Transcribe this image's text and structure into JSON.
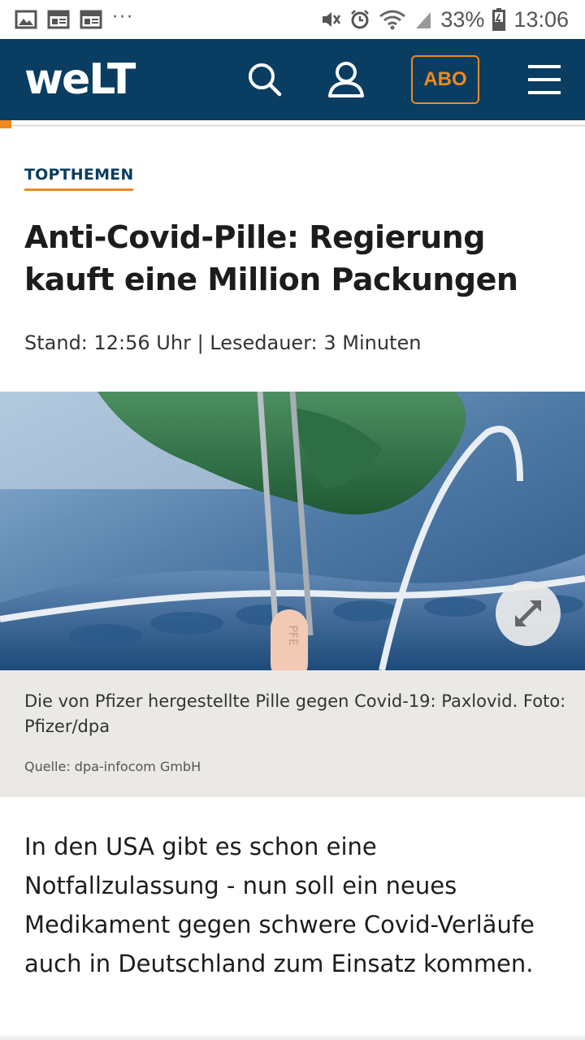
{
  "statusbar": {
    "battery": "33%",
    "time": "13:06",
    "left_icons": [
      "gallery-icon",
      "news-icon",
      "newspaper-icon",
      "more-dots-icon"
    ],
    "right_icons": [
      "mute-icon",
      "alarm-icon",
      "wifi-icon",
      "signal-icon",
      "battery-icon"
    ],
    "more": "···"
  },
  "header": {
    "logo": "weLT",
    "abo_label": "ABO",
    "background": "#0a3d62",
    "accent": "#ef8a1f",
    "icons": [
      "search-icon",
      "user-icon",
      "menu-icon"
    ]
  },
  "article": {
    "kicker": "TOPTHEMEN",
    "headline": "Anti-Covid-Pille: Regierung kauft eine Million Packungen",
    "meta": "Stand: 12:56 Uhr | Lesedauer: 3 Minuten",
    "caption": "Die von Pfizer hergestellte Pille gegen Covid-19: Paxlovid. Foto: Pfizer/dpa",
    "source": "Quelle: dpa-infocom GmbH",
    "lead": "In den USA gibt es schon eine Notfallzulassung - nun soll ein neues Medikament gegen schwere Covid-Verläufe auch in Deutschland zum Einsatz kommen.",
    "pill_imprint": "PFE"
  },
  "reading_progress": 0.02
}
